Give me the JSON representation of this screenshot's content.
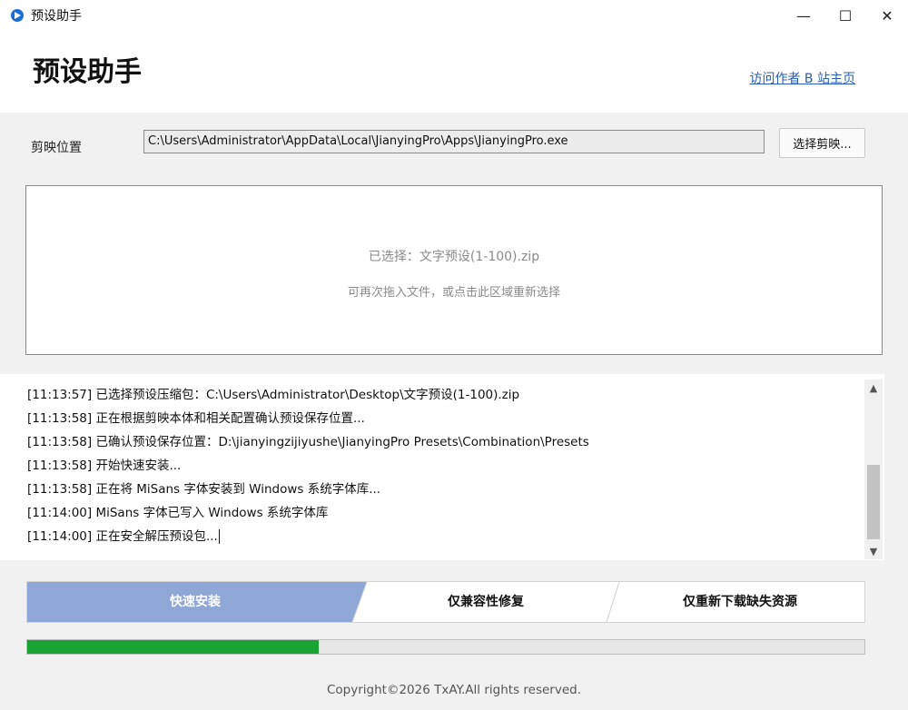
{
  "window": {
    "title": "预设助手",
    "minimize_glyph": "—",
    "maximize_glyph": "☐",
    "close_glyph": "✕"
  },
  "header": {
    "heading": "预设助手",
    "author_link": "访问作者 B 站主页"
  },
  "jianying_path": {
    "label": "剪映位置",
    "value": "C:\\Users\\Administrator\\AppData\\Local\\JianyingPro\\Apps\\JianyingPro.exe",
    "browse_label": "选择剪映..."
  },
  "dropzone": {
    "selected_text": "已选择：文字预设(1-100).zip",
    "hint_text": "可再次拖入文件，或点击此区域重新选择"
  },
  "log": {
    "lines": [
      "[11:13:57] 已选择预设压缩包：C:\\Users\\Administrator\\Desktop\\文字预设(1-100).zip",
      "[11:13:58] 正在根据剪映本体和相关配置确认预设保存位置...",
      "[11:13:58] 已确认预设保存位置：D:\\jianyingzijiyushe\\JianyingPro Presets\\Combination\\Presets",
      "[11:13:58] 开始快速安装...",
      "[11:13:58] 正在将 MiSans 字体安装到 Windows 系统字体库...",
      "[11:14:00] MiSans 字体已写入 Windows 系统字体库",
      "[11:14:00] 正在安全解压预设包..."
    ]
  },
  "actions": {
    "quick_install": "快速安装",
    "compat_repair": "仅兼容性修复",
    "redownload": "仅重新下载缺失资源",
    "active_color": "#8ea7d6"
  },
  "progress": {
    "fraction": 0.348,
    "color": "#17a433"
  },
  "footer": {
    "copyright": "Copyright©2026 TxAY.All rights reserved."
  }
}
